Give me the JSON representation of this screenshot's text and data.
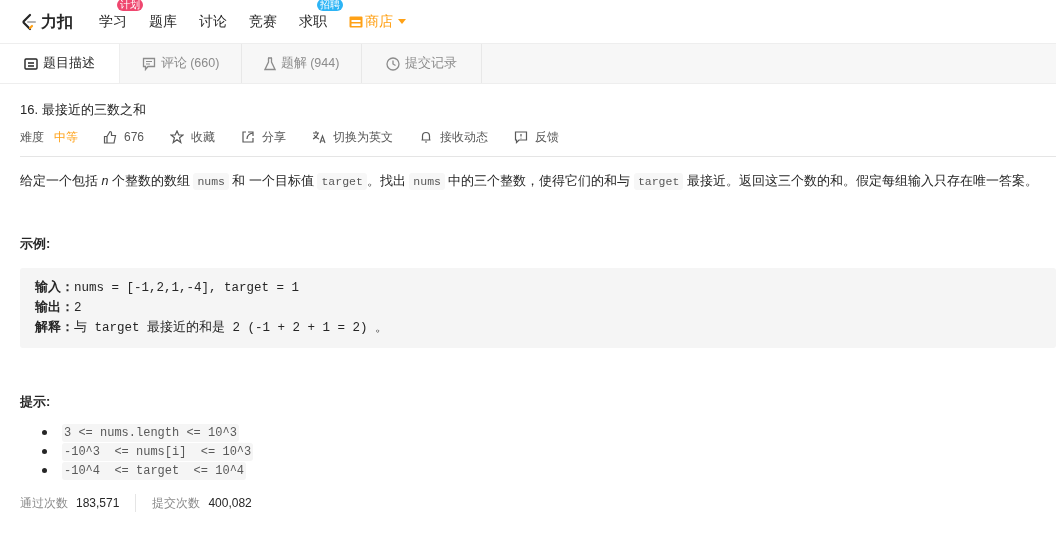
{
  "nav": {
    "logo_text": "力扣",
    "items": [
      {
        "label": "学习",
        "badge": "计划",
        "color": "#ef476f",
        "kind": "link"
      },
      {
        "label": "题库",
        "kind": "link"
      },
      {
        "label": "讨论",
        "kind": "link"
      },
      {
        "label": "竞赛",
        "kind": "link"
      },
      {
        "label": "求职",
        "badge": "招聘",
        "color": "#2db4f5",
        "kind": "link"
      },
      {
        "label": "商店",
        "kind": "store"
      }
    ]
  },
  "tabs": [
    {
      "label": "题目描述",
      "selected": true
    },
    {
      "label": "评论 (660)",
      "selected": false
    },
    {
      "label": "题解 (944)",
      "selected": false
    },
    {
      "label": "提交记录",
      "selected": false
    }
  ],
  "problem": {
    "title": "16. 最接近的三数之和",
    "difficulty_label": "难度",
    "difficulty": "中等",
    "actions": [
      {
        "label": "676"
      },
      {
        "label": "收藏"
      },
      {
        "label": "分享"
      },
      {
        "label": "切换为英文"
      },
      {
        "label": "接收动态"
      },
      {
        "label": "反馈"
      }
    ],
    "description": [
      {
        "kind": "text",
        "text": "给定一个包括 *n* 个整数的数组 "
      },
      {
        "kind": "code",
        "text": "nums"
      },
      {
        "kind": "text",
        "text": " 和 一个目标值 "
      },
      {
        "kind": "code",
        "text": "target"
      },
      {
        "kind": "text",
        "text": "。找出 "
      },
      {
        "kind": "code",
        "text": "nums"
      },
      {
        "kind": "text",
        "text": " 中的三个整数，使得它们的和与 "
      },
      {
        "kind": "code",
        "text": "target"
      },
      {
        "kind": "text",
        "text": " 最接近。返回这三个数的和。假定每组输入只存在唯一答案。"
      }
    ],
    "example_heading": "示例:",
    "example": [
      {
        "label": "输入：",
        "text": "nums = [-1,2,1,-4], target = 1"
      },
      {
        "label": "输出：",
        "text": "2"
      },
      {
        "label": "解释：",
        "text": "与 target 最接近的和是 2 (-1 + 2 + 1 = 2) 。"
      }
    ],
    "hints_heading": "提示:",
    "hints": [
      "3 <= nums.length <= 10^3",
      "-10^3  <= nums[i]  <= 10^3",
      "-10^4  <= target  <= 10^4"
    ],
    "stats": [
      {
        "label": "通过次数",
        "value": "183,571"
      },
      {
        "label": "提交次数",
        "value": "400,082"
      }
    ]
  }
}
